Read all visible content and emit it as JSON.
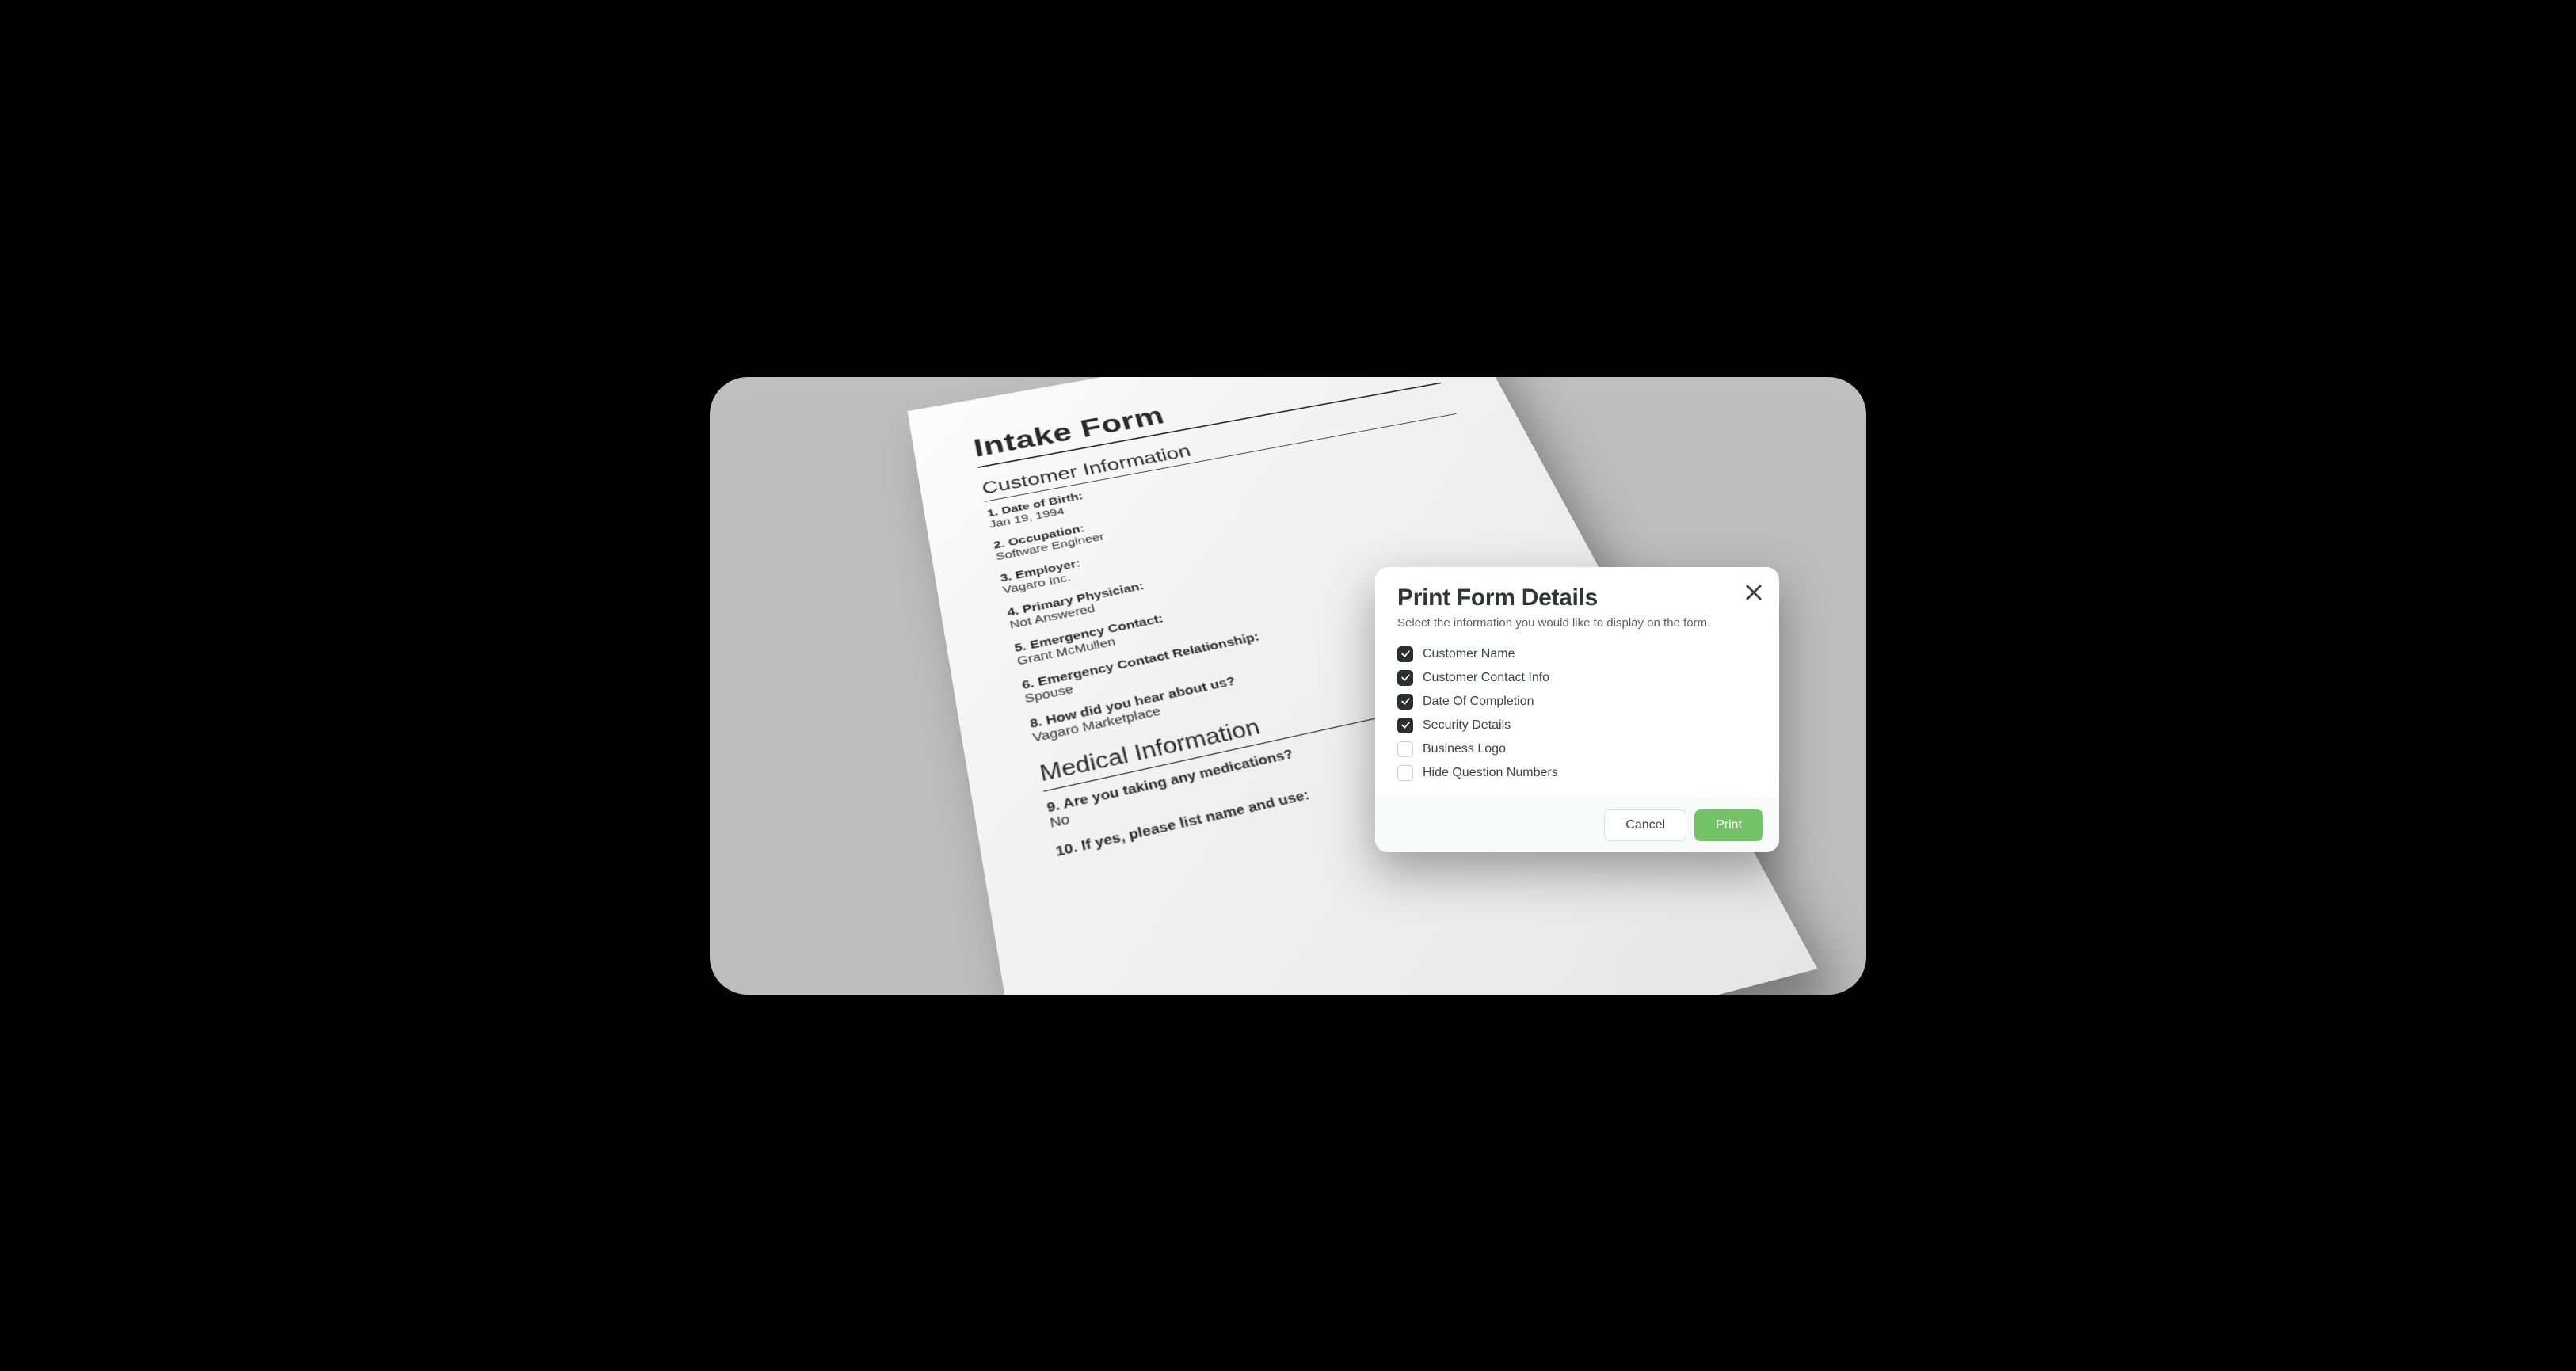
{
  "document": {
    "title": "Intake Form",
    "sections": [
      {
        "heading": "Customer Information",
        "items": [
          {
            "num": "1.",
            "q": "Date of Birth:",
            "a": "Jan 19, 1994"
          },
          {
            "num": "2.",
            "q": "Occupation:",
            "a": "Software Engineer"
          },
          {
            "num": "3.",
            "q": "Employer:",
            "a": "Vagaro Inc."
          },
          {
            "num": "4.",
            "q": "Primary Physician:",
            "a": "Not Answered"
          },
          {
            "num": "5.",
            "q": "Emergency Contact:",
            "a": "Grant McMullen"
          },
          {
            "num": "6.",
            "q": "Emergency Contact Relationship:",
            "a": "Spouse"
          },
          {
            "num": "8.",
            "q": "How did you hear about us?",
            "a": "Vagaro Marketplace"
          }
        ]
      },
      {
        "heading": "Medical Information",
        "items": [
          {
            "num": "9.",
            "q": "Are you taking any medications?",
            "a": "No"
          },
          {
            "num": "10.",
            "q": "If yes, please list name and use:",
            "a": ""
          }
        ]
      }
    ]
  },
  "modal": {
    "title": "Print Form Details",
    "subtitle": "Select the information you would like to display on the form.",
    "options": [
      {
        "label": "Customer Name",
        "checked": true
      },
      {
        "label": "Customer Contact Info",
        "checked": true
      },
      {
        "label": "Date Of Completion",
        "checked": true
      },
      {
        "label": "Security Details",
        "checked": true
      },
      {
        "label": "Business Logo",
        "checked": false
      },
      {
        "label": "Hide Question Numbers",
        "checked": false
      }
    ],
    "cancel_label": "Cancel",
    "print_label": "Print"
  }
}
